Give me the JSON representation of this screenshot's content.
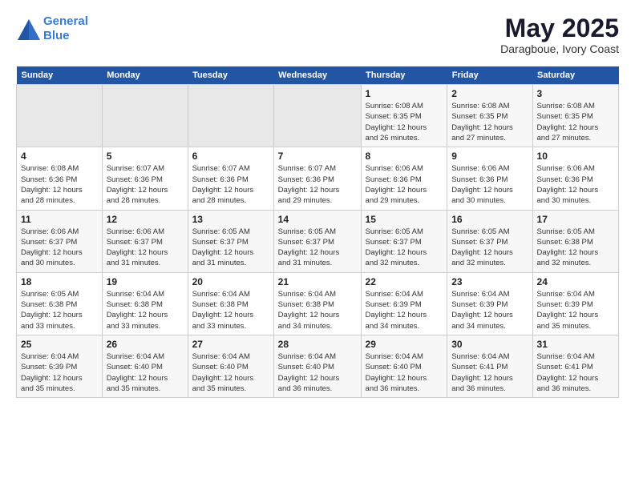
{
  "header": {
    "logo_line1": "General",
    "logo_line2": "Blue",
    "month": "May 2025",
    "location": "Daragboue, Ivory Coast"
  },
  "days_of_week": [
    "Sunday",
    "Monday",
    "Tuesday",
    "Wednesday",
    "Thursday",
    "Friday",
    "Saturday"
  ],
  "weeks": [
    [
      {
        "day": "",
        "info": ""
      },
      {
        "day": "",
        "info": ""
      },
      {
        "day": "",
        "info": ""
      },
      {
        "day": "",
        "info": ""
      },
      {
        "day": "1",
        "info": "Sunrise: 6:08 AM\nSunset: 6:35 PM\nDaylight: 12 hours\nand 26 minutes."
      },
      {
        "day": "2",
        "info": "Sunrise: 6:08 AM\nSunset: 6:35 PM\nDaylight: 12 hours\nand 27 minutes."
      },
      {
        "day": "3",
        "info": "Sunrise: 6:08 AM\nSunset: 6:35 PM\nDaylight: 12 hours\nand 27 minutes."
      }
    ],
    [
      {
        "day": "4",
        "info": "Sunrise: 6:08 AM\nSunset: 6:36 PM\nDaylight: 12 hours\nand 28 minutes."
      },
      {
        "day": "5",
        "info": "Sunrise: 6:07 AM\nSunset: 6:36 PM\nDaylight: 12 hours\nand 28 minutes."
      },
      {
        "day": "6",
        "info": "Sunrise: 6:07 AM\nSunset: 6:36 PM\nDaylight: 12 hours\nand 28 minutes."
      },
      {
        "day": "7",
        "info": "Sunrise: 6:07 AM\nSunset: 6:36 PM\nDaylight: 12 hours\nand 29 minutes."
      },
      {
        "day": "8",
        "info": "Sunrise: 6:06 AM\nSunset: 6:36 PM\nDaylight: 12 hours\nand 29 minutes."
      },
      {
        "day": "9",
        "info": "Sunrise: 6:06 AM\nSunset: 6:36 PM\nDaylight: 12 hours\nand 30 minutes."
      },
      {
        "day": "10",
        "info": "Sunrise: 6:06 AM\nSunset: 6:36 PM\nDaylight: 12 hours\nand 30 minutes."
      }
    ],
    [
      {
        "day": "11",
        "info": "Sunrise: 6:06 AM\nSunset: 6:37 PM\nDaylight: 12 hours\nand 30 minutes."
      },
      {
        "day": "12",
        "info": "Sunrise: 6:06 AM\nSunset: 6:37 PM\nDaylight: 12 hours\nand 31 minutes."
      },
      {
        "day": "13",
        "info": "Sunrise: 6:05 AM\nSunset: 6:37 PM\nDaylight: 12 hours\nand 31 minutes."
      },
      {
        "day": "14",
        "info": "Sunrise: 6:05 AM\nSunset: 6:37 PM\nDaylight: 12 hours\nand 31 minutes."
      },
      {
        "day": "15",
        "info": "Sunrise: 6:05 AM\nSunset: 6:37 PM\nDaylight: 12 hours\nand 32 minutes."
      },
      {
        "day": "16",
        "info": "Sunrise: 6:05 AM\nSunset: 6:37 PM\nDaylight: 12 hours\nand 32 minutes."
      },
      {
        "day": "17",
        "info": "Sunrise: 6:05 AM\nSunset: 6:38 PM\nDaylight: 12 hours\nand 32 minutes."
      }
    ],
    [
      {
        "day": "18",
        "info": "Sunrise: 6:05 AM\nSunset: 6:38 PM\nDaylight: 12 hours\nand 33 minutes."
      },
      {
        "day": "19",
        "info": "Sunrise: 6:04 AM\nSunset: 6:38 PM\nDaylight: 12 hours\nand 33 minutes."
      },
      {
        "day": "20",
        "info": "Sunrise: 6:04 AM\nSunset: 6:38 PM\nDaylight: 12 hours\nand 33 minutes."
      },
      {
        "day": "21",
        "info": "Sunrise: 6:04 AM\nSunset: 6:38 PM\nDaylight: 12 hours\nand 34 minutes."
      },
      {
        "day": "22",
        "info": "Sunrise: 6:04 AM\nSunset: 6:39 PM\nDaylight: 12 hours\nand 34 minutes."
      },
      {
        "day": "23",
        "info": "Sunrise: 6:04 AM\nSunset: 6:39 PM\nDaylight: 12 hours\nand 34 minutes."
      },
      {
        "day": "24",
        "info": "Sunrise: 6:04 AM\nSunset: 6:39 PM\nDaylight: 12 hours\nand 35 minutes."
      }
    ],
    [
      {
        "day": "25",
        "info": "Sunrise: 6:04 AM\nSunset: 6:39 PM\nDaylight: 12 hours\nand 35 minutes."
      },
      {
        "day": "26",
        "info": "Sunrise: 6:04 AM\nSunset: 6:40 PM\nDaylight: 12 hours\nand 35 minutes."
      },
      {
        "day": "27",
        "info": "Sunrise: 6:04 AM\nSunset: 6:40 PM\nDaylight: 12 hours\nand 35 minutes."
      },
      {
        "day": "28",
        "info": "Sunrise: 6:04 AM\nSunset: 6:40 PM\nDaylight: 12 hours\nand 36 minutes."
      },
      {
        "day": "29",
        "info": "Sunrise: 6:04 AM\nSunset: 6:40 PM\nDaylight: 12 hours\nand 36 minutes."
      },
      {
        "day": "30",
        "info": "Sunrise: 6:04 AM\nSunset: 6:41 PM\nDaylight: 12 hours\nand 36 minutes."
      },
      {
        "day": "31",
        "info": "Sunrise: 6:04 AM\nSunset: 6:41 PM\nDaylight: 12 hours\nand 36 minutes."
      }
    ]
  ]
}
